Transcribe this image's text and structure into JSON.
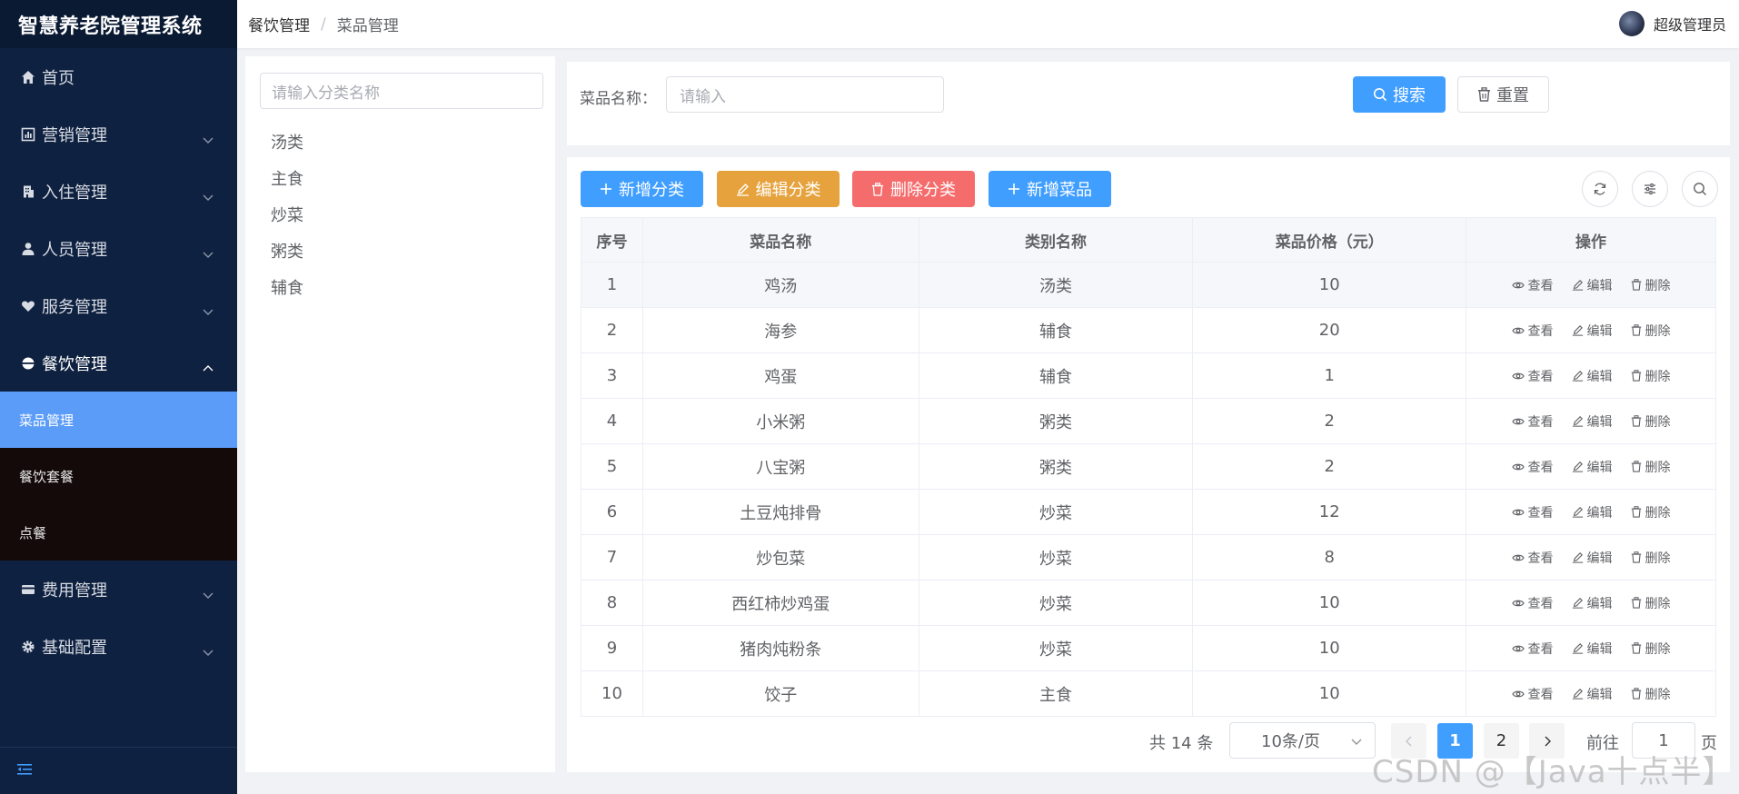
{
  "app": {
    "title": "智慧养老院管理系统"
  },
  "breadcrumb": [
    "餐饮管理",
    "菜品管理"
  ],
  "user": {
    "name": "超级管理员"
  },
  "sidebar": {
    "items": [
      {
        "label": "首页",
        "icon": "home-icon",
        "has_arrow": false
      },
      {
        "label": "营销管理",
        "icon": "chart-icon",
        "has_arrow": true
      },
      {
        "label": "入住管理",
        "icon": "building-icon",
        "has_arrow": true
      },
      {
        "label": "人员管理",
        "icon": "person-icon",
        "has_arrow": true
      },
      {
        "label": "服务管理",
        "icon": "heart-hand-icon",
        "has_arrow": true
      },
      {
        "label": "餐饮管理",
        "icon": "bowl-icon",
        "has_arrow": true,
        "open": true
      },
      {
        "label": "费用管理",
        "icon": "card-icon",
        "has_arrow": true
      },
      {
        "label": "基础配置",
        "icon": "gear-icon",
        "has_arrow": true
      }
    ],
    "sub_items": [
      {
        "label": "菜品管理",
        "active": true
      },
      {
        "label": "餐饮套餐",
        "active": false
      },
      {
        "label": "点餐",
        "active": false
      }
    ],
    "collapse_icon": "collapse-menu-icon"
  },
  "category": {
    "placeholder": "请输入分类名称",
    "items": [
      "汤类",
      "主食",
      "炒菜",
      "粥类",
      "辅食"
    ]
  },
  "search": {
    "label": "菜品名称：",
    "placeholder": "请输入",
    "search_btn": "搜索",
    "reset_btn": "重置"
  },
  "toolbar": {
    "add_category": "新增分类",
    "edit_category": "编辑分类",
    "delete_category": "删除分类",
    "add_dish": "新增菜品"
  },
  "table": {
    "headers": [
      "序号",
      "菜品名称",
      "类别名称",
      "菜品价格（元）",
      "操作"
    ],
    "rows": [
      [
        "1",
        "鸡汤",
        "汤类",
        "10"
      ],
      [
        "2",
        "海参",
        "辅食",
        "20"
      ],
      [
        "3",
        "鸡蛋",
        "辅食",
        "1"
      ],
      [
        "4",
        "小米粥",
        "粥类",
        "2"
      ],
      [
        "5",
        "八宝粥",
        "粥类",
        "2"
      ],
      [
        "6",
        "土豆炖排骨",
        "炒菜",
        "12"
      ],
      [
        "7",
        "炒包菜",
        "炒菜",
        "8"
      ],
      [
        "8",
        "西红柿炒鸡蛋",
        "炒菜",
        "10"
      ],
      [
        "9",
        "猪肉炖粉条",
        "炒菜",
        "10"
      ],
      [
        "10",
        "饺子",
        "主食",
        "10"
      ]
    ],
    "ops": {
      "view": "查看",
      "edit": "编辑",
      "delete": "删除"
    }
  },
  "pagination": {
    "total": "共 14 条",
    "page_size": "10条/页",
    "pages": [
      "1",
      "2"
    ],
    "current": "1",
    "jump_prefix": "前往",
    "jump_value": "1",
    "jump_suffix": "页"
  },
  "watermark": "CSDN @【Java十点半】",
  "colors": {
    "primary": "#409eff",
    "warning": "#e6a23c",
    "danger": "#f56c6c",
    "sidebar": "#0f2140",
    "active_sub": "#5b9cf8"
  }
}
